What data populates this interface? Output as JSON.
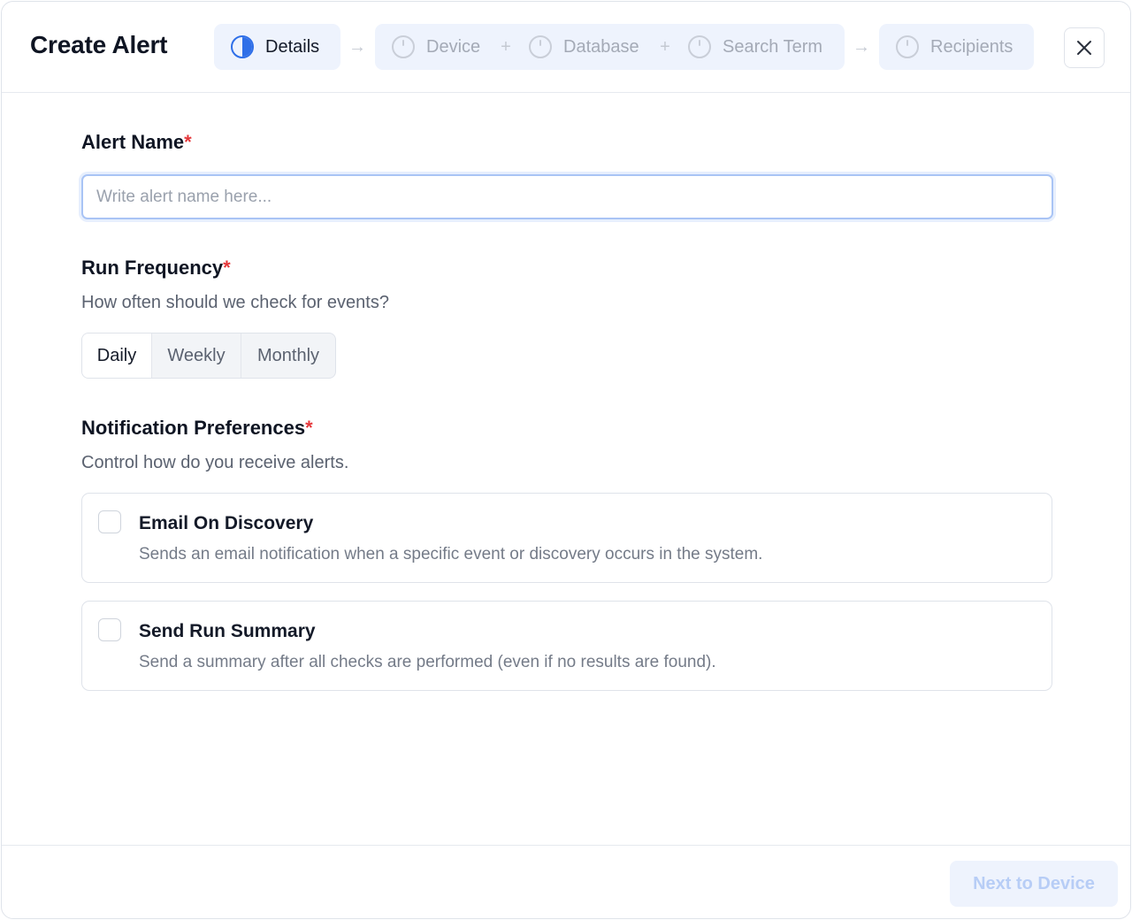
{
  "header": {
    "title": "Create Alert",
    "steps": [
      {
        "label": "Details",
        "active": true
      },
      {
        "label": "Device",
        "active": false
      },
      {
        "label": "Database",
        "active": false
      },
      {
        "label": "Search Term",
        "active": false
      },
      {
        "label": "Recipients",
        "active": false
      }
    ],
    "separators": [
      "→",
      "+",
      "+",
      "→"
    ],
    "close_icon": "close-icon"
  },
  "alert_name": {
    "label": "Alert Name",
    "required_mark": "*",
    "value": "",
    "placeholder": "Write alert name here..."
  },
  "run_frequency": {
    "label": "Run Frequency",
    "required_mark": "*",
    "description": "How often should we check for events?",
    "options": [
      "Daily",
      "Weekly",
      "Monthly"
    ],
    "selected": "Daily"
  },
  "notifications": {
    "label": "Notification Preferences",
    "required_mark": "*",
    "description": "Control how do you receive alerts.",
    "options": [
      {
        "title": "Email On Discovery",
        "description": "Sends an email notification when a specific event or discovery occurs in the system.",
        "checked": false
      },
      {
        "title": "Send Run Summary",
        "description": "Send a summary after all checks are performed (even if no results are found).",
        "checked": false
      }
    ]
  },
  "footer": {
    "next_label": "Next to Device",
    "next_enabled": false
  },
  "colors": {
    "accent": "#2f6fe8",
    "required": "#e5383b",
    "step_bg": "#eef3fd"
  }
}
